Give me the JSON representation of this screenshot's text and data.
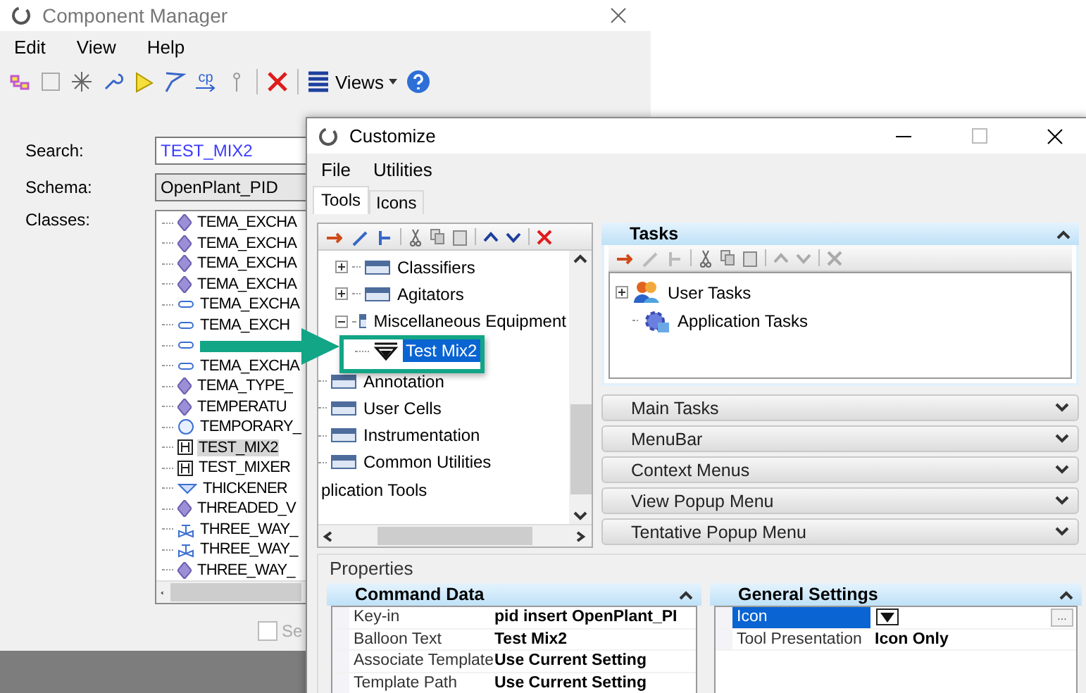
{
  "component_manager": {
    "title": "Component Manager",
    "menu": [
      "Edit",
      "View",
      "Help"
    ],
    "toolbar": {
      "copy_label": "cp",
      "views_label": "Views"
    },
    "search": {
      "label": "Search:",
      "value": "TEST_MIX2"
    },
    "schema": {
      "label": "Schema:",
      "value": "OpenPlant_PID"
    },
    "classes": {
      "label": "Classes:",
      "items": [
        {
          "name": "TEMA_EXCHA",
          "kind": "diamond",
          "selected": false
        },
        {
          "name": "TEMA_EXCHA",
          "kind": "diamond",
          "selected": false
        },
        {
          "name": "TEMA_EXCHA",
          "kind": "diamond",
          "selected": false
        },
        {
          "name": "TEMA_EXCHA",
          "kind": "diamond",
          "selected": false
        },
        {
          "name": "TEMA_EXCHA",
          "kind": "tube",
          "selected": false
        },
        {
          "name": "TEMA_EXCH",
          "kind": "tube",
          "selected": false
        },
        {
          "kind": "tube",
          "selected": false
        },
        {
          "name": "TEMA_EXCHA",
          "kind": "tube",
          "selected": false
        },
        {
          "name": "TEMA_TYPE_",
          "kind": "diamond",
          "selected": false
        },
        {
          "name": "TEMPERATU",
          "kind": "diamond",
          "selected": false
        },
        {
          "name": "TEMPORARY_",
          "kind": "circle",
          "selected": false
        },
        {
          "name": "TEST_MIX2",
          "kind": "mixer",
          "selected": true
        },
        {
          "name": "TEST_MIXER",
          "kind": "mixer",
          "selected": false
        },
        {
          "name": "THICKENER",
          "kind": "thickener",
          "selected": false
        },
        {
          "name": "THREADED_V",
          "kind": "diamond",
          "selected": false
        },
        {
          "name": "THREE_WAY_",
          "kind": "valve",
          "selected": false
        },
        {
          "name": "THREE_WAY_",
          "kind": "valve",
          "selected": false
        },
        {
          "name": "THREE_WAY_",
          "kind": "diamond",
          "selected": false
        }
      ]
    },
    "search_option": {
      "label": "Se",
      "checked": false
    }
  },
  "customize": {
    "title": "Customize",
    "menu": [
      "File",
      "Utilities"
    ],
    "tabs": [
      {
        "label": "Tools",
        "selected": true
      },
      {
        "label": "Icons",
        "selected": false
      }
    ],
    "tools_tree": {
      "nested_items": [
        {
          "label": "Classifiers",
          "expanded": false,
          "selected": false
        },
        {
          "label": "Agitators",
          "expanded": false,
          "selected": false
        },
        {
          "label": "Miscellaneous Equipment",
          "expanded": true,
          "selected": false,
          "children": [
            {
              "label": "Test Mix2",
              "selected": true
            }
          ]
        }
      ],
      "items": [
        {
          "label": "Annotation",
          "selected": false
        },
        {
          "label": "User Cells",
          "selected": false
        },
        {
          "label": "Instrumentation",
          "selected": false
        },
        {
          "label": "Common Utilities",
          "selected": false
        }
      ],
      "root_label": "plication Tools"
    },
    "tasks": {
      "title": "Tasks",
      "expanded": true,
      "items": [
        {
          "label": "User Tasks",
          "expanded": false,
          "kind": "users"
        },
        {
          "label": "Application Tasks",
          "kind": "app"
        }
      ]
    },
    "sections": [
      {
        "label": "Main Tasks",
        "expanded": false
      },
      {
        "label": "MenuBar",
        "expanded": false
      },
      {
        "label": "Context Menus",
        "expanded": false
      },
      {
        "label": "View Popup Menu",
        "expanded": false
      },
      {
        "label": "Tentative Popup Menu",
        "expanded": false
      }
    ],
    "properties": {
      "label": "Properties",
      "command_data": {
        "title": "Command Data",
        "expanded": true,
        "rows": [
          {
            "name": "Key-in",
            "value": "pid insert OpenPlant_PI"
          },
          {
            "name": "Balloon Text",
            "value": "Test Mix2"
          },
          {
            "name": "Associate Template",
            "value": "Use Current Setting"
          },
          {
            "name": "Template Path",
            "value": "Use Current Setting"
          }
        ]
      },
      "general_settings": {
        "title": "General Settings",
        "expanded": true,
        "rows": [
          {
            "name": "Icon",
            "kind": "icon",
            "selected": true,
            "button_label": "..."
          },
          {
            "name": "Tool Presentation",
            "kind": "text",
            "value": "Icon Only",
            "selected": false
          }
        ]
      }
    }
  }
}
